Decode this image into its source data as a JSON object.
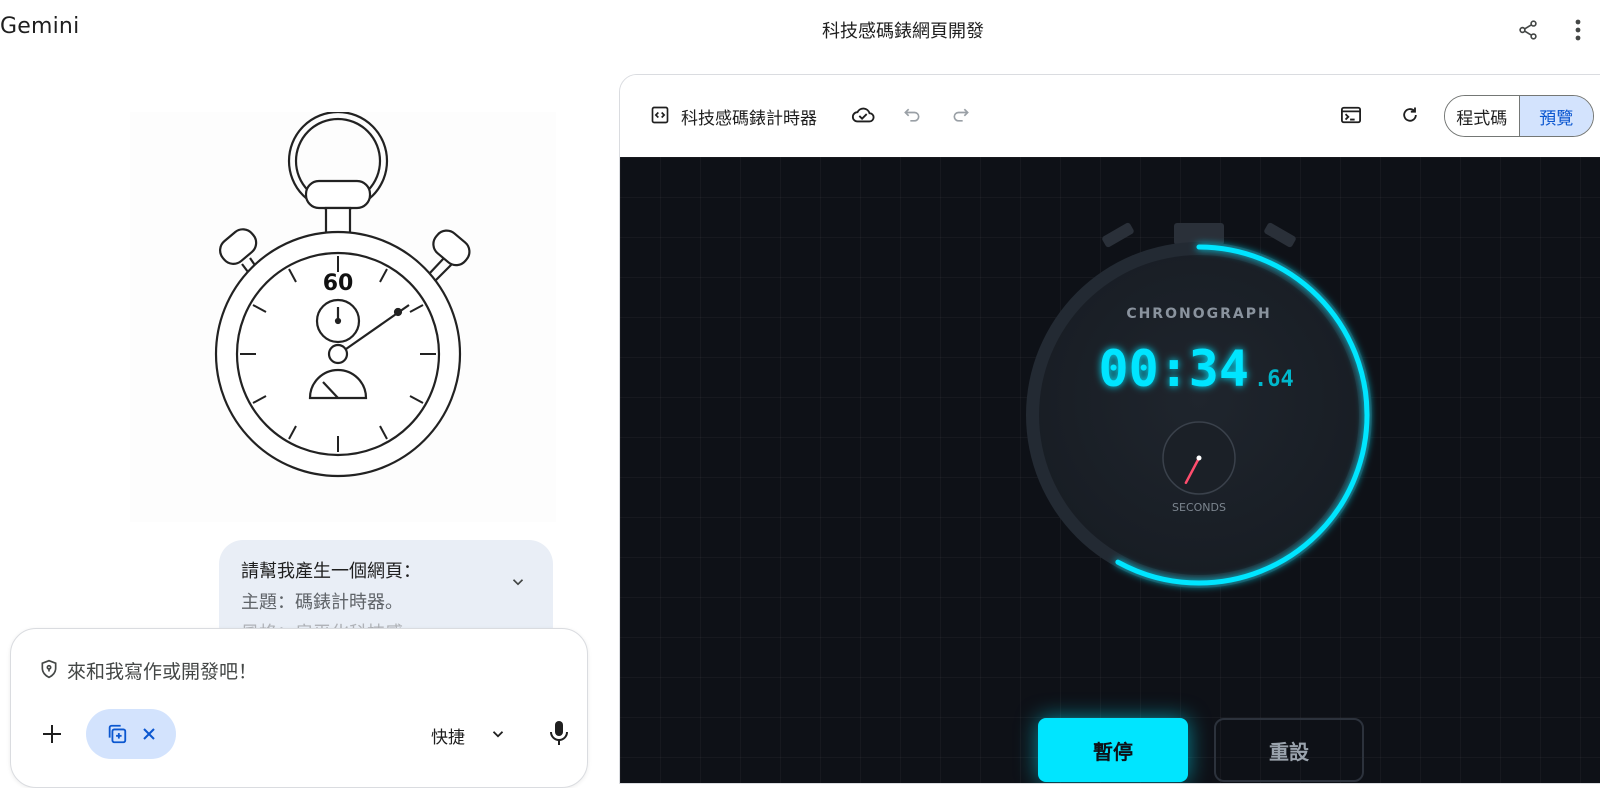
{
  "header": {
    "brand": "Gemini",
    "conversation_title": "科技感碼錶網頁開發",
    "share_icon": "share-icon",
    "more_icon": "more-vert-icon"
  },
  "chat": {
    "image_alt_icon": "stopwatch-illustration",
    "image_dial_number": "60",
    "user_message": {
      "line1": "請幫我產生一個網頁：",
      "line2": "主題：碼錶計時器。",
      "line3": "風格：扁平化科技感。"
    },
    "composer": {
      "placeholder": "來和我寫作或開發吧！",
      "mode_label": "快捷"
    }
  },
  "canvas": {
    "title": "科技感碼錶計時器",
    "tabs": {
      "code": "程式碼",
      "preview": "預覽",
      "selected": "preview"
    },
    "preview": {
      "label": "CHRONOGRAPH",
      "time_main": "00:34",
      "time_ms": ".64",
      "sub_dial_label": "SECONDS",
      "progress_fraction": 0.58,
      "pause_label": "暫停",
      "reset_label": "重設"
    }
  },
  "colors": {
    "accent_cyan": "#00e5ff",
    "preview_bg": "#0e1117",
    "second_hand": "#ff4d6d",
    "selected_tab_bg": "#d3e3fd",
    "selected_tab_text": "#0b57d0"
  }
}
